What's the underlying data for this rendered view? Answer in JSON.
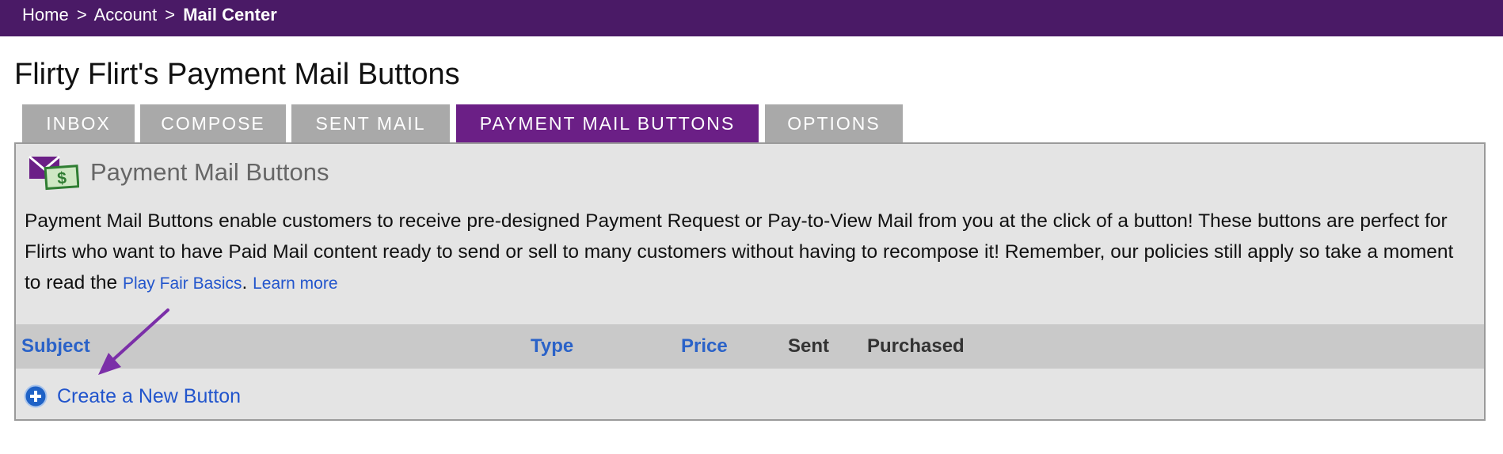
{
  "breadcrumb": {
    "items": [
      "Home",
      "Account"
    ],
    "separator": ">",
    "current": "Mail Center"
  },
  "page_title": "Flirty Flirt's Payment Mail Buttons",
  "tabs": [
    {
      "label": "INBOX",
      "active": false
    },
    {
      "label": "COMPOSE",
      "active": false
    },
    {
      "label": "SENT MAIL",
      "active": false
    },
    {
      "label": "PAYMENT MAIL BUTTONS",
      "active": true
    },
    {
      "label": "OPTIONS",
      "active": false
    }
  ],
  "panel": {
    "title": "Payment Mail Buttons",
    "icon": "payment-mail-icon",
    "description": "Payment Mail Buttons enable customers to receive pre-designed Payment Request or Pay-to-View Mail from you at the click of a button! These buttons are perfect for Flirts who want to have Paid Mail content ready to send or sell to many customers without having to recompose it! Remember, our policies still apply so take a moment to read the",
    "play_fair_link": "Play Fair Basics",
    "period": ".",
    "learn_more_link": "Learn more"
  },
  "table": {
    "columns": [
      {
        "label": "Subject",
        "sortable": true
      },
      {
        "label": "Type",
        "sortable": true
      },
      {
        "label": "Price",
        "sortable": true
      },
      {
        "label": "Sent",
        "sortable": false
      },
      {
        "label": "Purchased",
        "sortable": false
      }
    ]
  },
  "create_button": {
    "label": "Create a New Button",
    "icon": "plus-circle-icon"
  },
  "colors": {
    "topbar": "#4a1a66",
    "active_tab": "#6b1f86",
    "inactive_tab": "#a9a9a9",
    "link": "#2255cc",
    "annotation_arrow": "#7b2fa8"
  }
}
